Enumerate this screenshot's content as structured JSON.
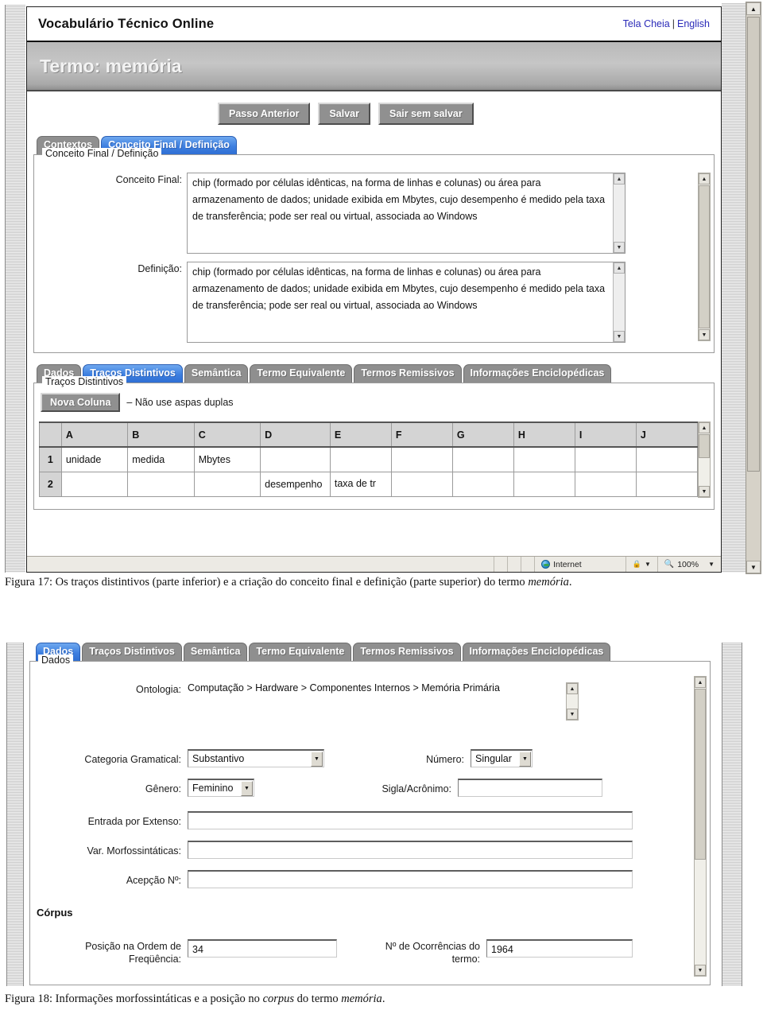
{
  "figure17": {
    "browser": {
      "site_title": "Vocabulário Técnico Online",
      "link_fullscreen": "Tela Cheia",
      "link_separator": "|",
      "link_english": "English",
      "term_banner": "Termo: memória"
    },
    "buttons": {
      "previous_step": "Passo Anterior",
      "save": "Salvar",
      "exit_without_saving": "Sair sem salvar"
    },
    "tabs_top": [
      {
        "label": "Contextos",
        "active": false
      },
      {
        "label": "Conceito Final / Definição",
        "active": true
      }
    ],
    "concept_group": {
      "legend": "Conceito Final / Definição",
      "final_concept_label": "Conceito Final:",
      "final_concept_value": "chip (formado por células idênticas, na forma de linhas e colunas) ou área para armazenamento de dados; unidade exibida em Mbytes, cujo desempenho é medido pela taxa de transferência; pode ser real ou virtual, associada ao Windows",
      "definition_label": "Definição:",
      "definition_value": "chip (formado por células idênticas, na forma de linhas e colunas) ou área para armazenamento de dados; unidade exibida em Mbytes, cujo desempenho é medido pela taxa de transferência; pode ser real ou virtual, associada ao Windows"
    },
    "tabs_bottom": [
      {
        "label": "Dados",
        "active": false
      },
      {
        "label": "Traços Distintivos",
        "active": true
      },
      {
        "label": "Semântica",
        "active": false
      },
      {
        "label": "Termo Equivalente",
        "active": false
      },
      {
        "label": "Termos Remissivos",
        "active": false
      },
      {
        "label": "Informações Enciclopédicas",
        "active": false
      }
    ],
    "traits_group": {
      "legend": "Traços Distintivos",
      "new_column_button": "Nova Coluna",
      "hint": "– Não use aspas duplas",
      "columns": [
        "A",
        "B",
        "C",
        "D",
        "E",
        "F",
        "G",
        "H",
        "I",
        "J"
      ],
      "rows": [
        {
          "num": "1",
          "cells": [
            "unidade",
            "medida",
            "Mbytes",
            "",
            "",
            "",
            "",
            "",
            "",
            ""
          ]
        },
        {
          "num": "2",
          "cells": [
            "",
            "",
            "",
            "desempenho",
            "taxa de tr",
            "",
            "",
            "",
            "",
            ""
          ]
        }
      ]
    },
    "statusbar": {
      "zone": "Internet",
      "zoom": "100%"
    },
    "caption_prefix": "Figura 17: Os traços distintivos (parte inferior) e a criação do conceito final e definição (parte superior) do termo ",
    "caption_italic": "memória",
    "caption_suffix": "."
  },
  "figure18": {
    "tabs": [
      {
        "label": "Dados",
        "active": true
      },
      {
        "label": "Traços Distintivos",
        "active": false
      },
      {
        "label": "Semântica",
        "active": false
      },
      {
        "label": "Termo Equivalente",
        "active": false
      },
      {
        "label": "Termos Remissivos",
        "active": false
      },
      {
        "label": "Informações Enciclopédicas",
        "active": false
      }
    ],
    "group_legend": "Dados",
    "fields": {
      "ontology_label": "Ontologia:",
      "ontology_value": "Computação > Hardware > Componentes Internos > Memória Primária",
      "grammatical_category_label": "Categoria Gramatical:",
      "grammatical_category_value": "Substantivo",
      "number_label": "Número:",
      "number_value": "Singular",
      "gender_label": "Gênero:",
      "gender_value": "Feminino",
      "acronym_label": "Sigla/Acrônimo:",
      "acronym_value": "",
      "full_entry_label": "Entrada por Extenso:",
      "full_entry_value": "",
      "morphosyntactic_var_label": "Var. Morfossintáticas:",
      "morphosyntactic_var_value": "",
      "sense_number_label": "Acepção Nº:",
      "sense_number_value": ""
    },
    "corpus": {
      "heading": "Córpus",
      "frequency_rank_label_line1": "Posição na Ordem de",
      "frequency_rank_label_line2": "Freqüência:",
      "frequency_rank_value": "34",
      "occurrences_label_line1": "Nº de Ocorrências do",
      "occurrences_label_line2": "termo:",
      "occurrences_value": "1964"
    },
    "caption_prefix": "Figura 18: Informações morfossintáticas e a posição no ",
    "caption_italic1": "corpus",
    "caption_middle": " do termo ",
    "caption_italic2": "memória",
    "caption_suffix": "."
  }
}
